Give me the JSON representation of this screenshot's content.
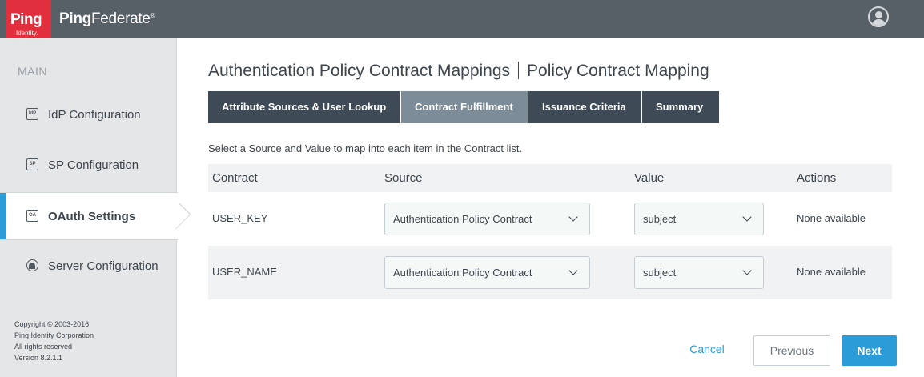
{
  "header": {
    "logo_text": "Ping",
    "logo_subtext": "Identity.",
    "product_name_bold": "Ping",
    "product_name_rest": "Federate",
    "product_name_mark": "®"
  },
  "sidebar": {
    "heading": "MAIN",
    "items": [
      {
        "label": "IdP Configuration",
        "icon": "IdP"
      },
      {
        "label": "SP Configuration",
        "icon": "SP"
      },
      {
        "label": "OAuth Settings",
        "icon": "OA"
      },
      {
        "label": "Server Configuration",
        "icon": "server-icon"
      }
    ],
    "copyright": [
      "Copyright © 2003-2016",
      "Ping Identity Corporation",
      "All rights reserved",
      "Version 8.2.1.1"
    ]
  },
  "page": {
    "title_main": "Authentication Policy Contract Mappings",
    "title_sub": "Policy Contract Mapping",
    "tabs": [
      {
        "label": "Attribute Sources & User Lookup"
      },
      {
        "label": "Contract Fulfillment"
      },
      {
        "label": "Issuance Criteria"
      },
      {
        "label": "Summary"
      }
    ],
    "instructions": "Select a Source and Value to map into each item in the Contract list."
  },
  "table": {
    "headers": {
      "contract": "Contract",
      "source": "Source",
      "value": "Value",
      "actions": "Actions"
    },
    "rows": [
      {
        "contract": "USER_KEY",
        "source": "Authentication Policy Contract",
        "value": "subject",
        "actions": "None available"
      },
      {
        "contract": "USER_NAME",
        "source": "Authentication Policy Contract",
        "value": "subject",
        "actions": "None available"
      }
    ]
  },
  "footer": {
    "cancel": "Cancel",
    "previous": "Previous",
    "next": "Next"
  },
  "colors": {
    "topbar": "#575f67",
    "brand_red": "#e12f3d",
    "accent_blue": "#2b9cd8",
    "tab_dark": "#3e4a55",
    "tab_active": "#7d8c99"
  }
}
